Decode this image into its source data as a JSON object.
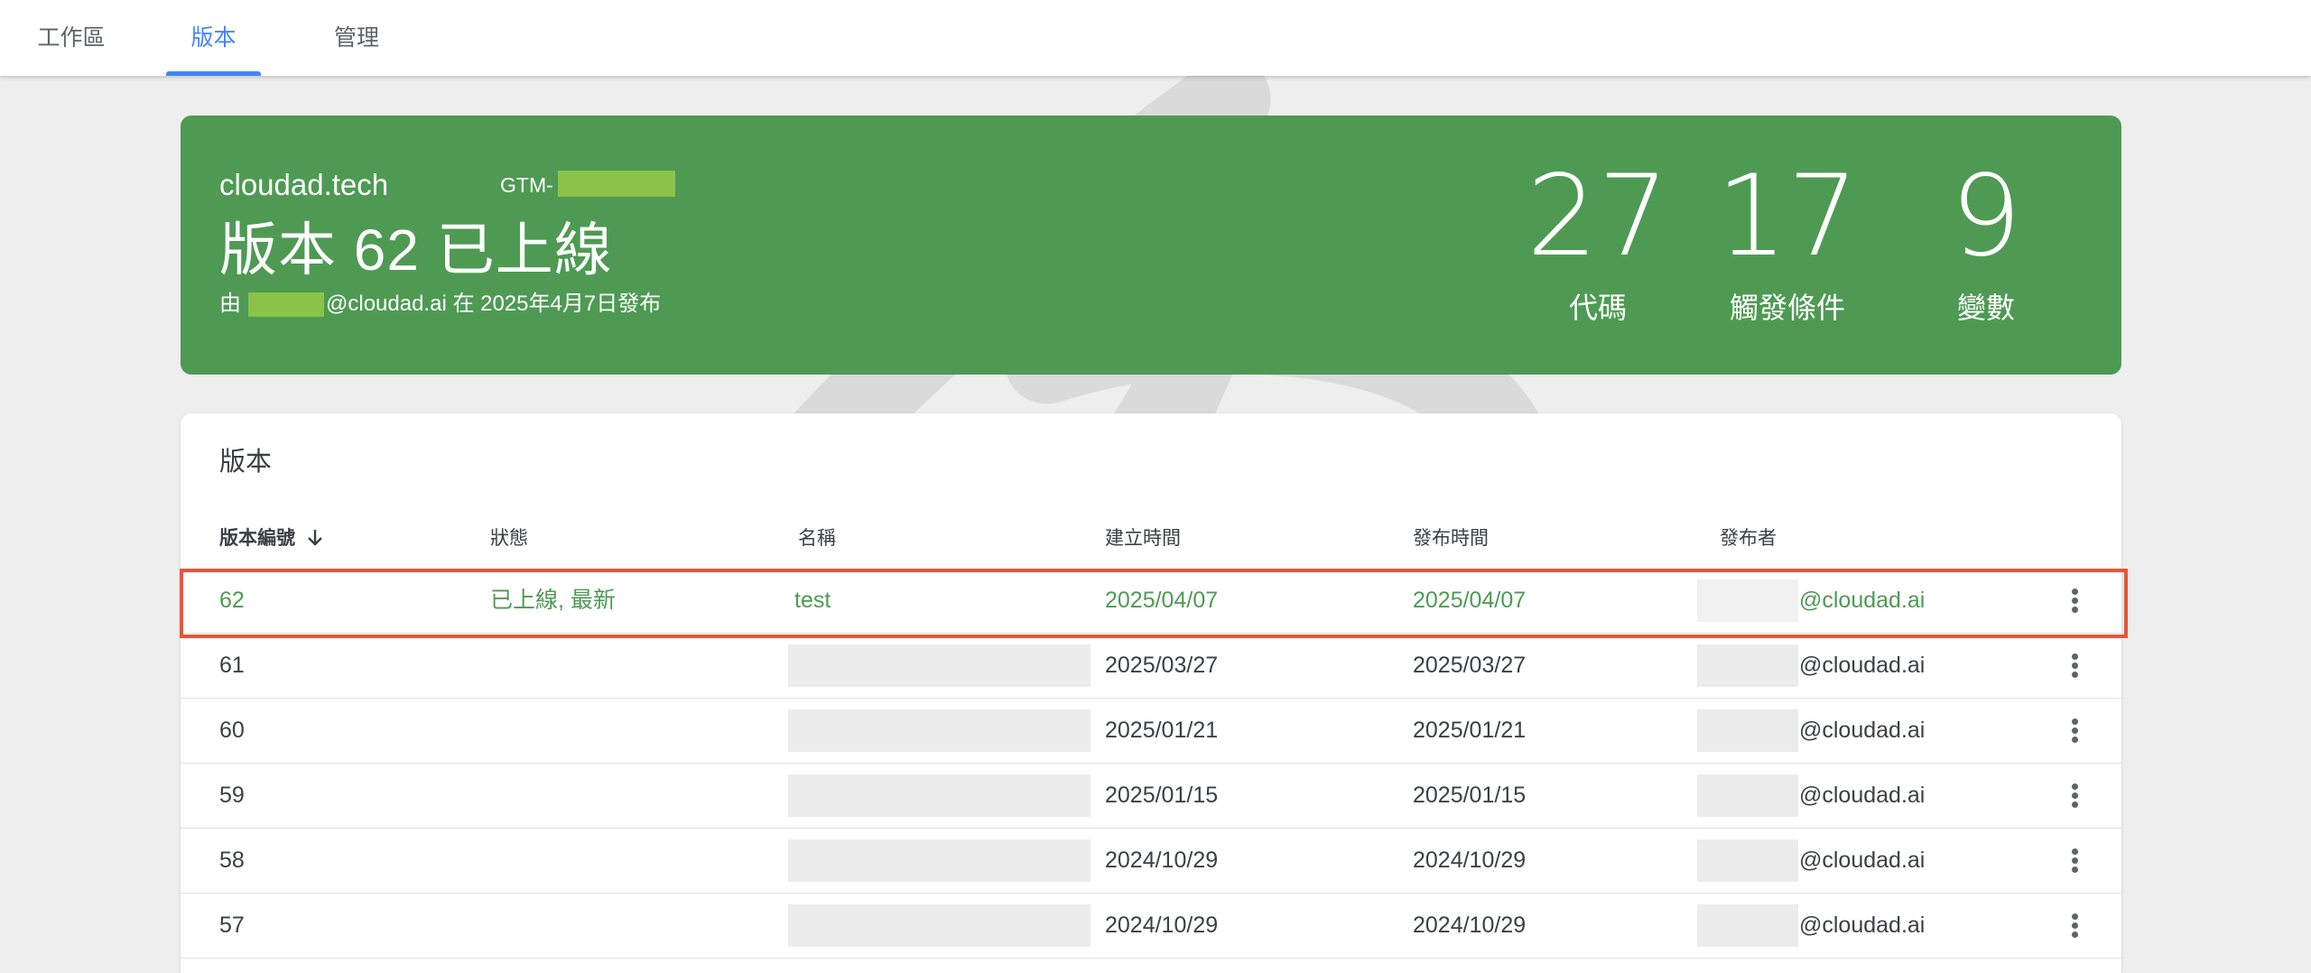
{
  "tabs": [
    {
      "label": "工作區",
      "active": false
    },
    {
      "label": "版本",
      "active": true
    },
    {
      "label": "管理",
      "active": false
    }
  ],
  "hero": {
    "site": "cloudad.tech",
    "gtm_prefix": "GTM-",
    "title": "版本 62 已上線",
    "publish_prefix": "由",
    "publish_suffix": "@cloudad.ai 在 2025年4月7日發布",
    "stats": [
      {
        "value": "27",
        "label": "代碼"
      },
      {
        "value": "17",
        "label": "觸發條件"
      },
      {
        "value": "9",
        "label": "變數"
      }
    ],
    "color": "#4e9a53"
  },
  "table": {
    "title": "版本",
    "columns": [
      "版本編號",
      "狀態",
      "名稱",
      "建立時間",
      "發布時間",
      "發布者"
    ],
    "sort_icon": "arrow-down-icon",
    "rows": [
      {
        "number": "62",
        "status": "已上線, 最新",
        "name": "test",
        "created": "2025/04/07",
        "published": "2025/04/07",
        "publisher": "@cloudad.ai"
      },
      {
        "number": "61",
        "status": "",
        "name": "",
        "created": "2025/03/27",
        "published": "2025/03/27",
        "publisher": "@cloudad.ai"
      },
      {
        "number": "60",
        "status": "",
        "name": "",
        "created": "2025/01/21",
        "published": "2025/01/21",
        "publisher": "@cloudad.ai"
      },
      {
        "number": "59",
        "status": "",
        "name": "",
        "created": "2025/01/15",
        "published": "2025/01/15",
        "publisher": "@cloudad.ai"
      },
      {
        "number": "58",
        "status": "",
        "name": "",
        "created": "2024/10/29",
        "published": "2024/10/29",
        "publisher": "@cloudad.ai"
      },
      {
        "number": "57",
        "status": "",
        "name": "",
        "created": "2024/10/29",
        "published": "2024/10/29",
        "publisher": "@cloudad.ai"
      }
    ],
    "live_color": "#4e9a53",
    "highlight_color": "#e8553a"
  }
}
